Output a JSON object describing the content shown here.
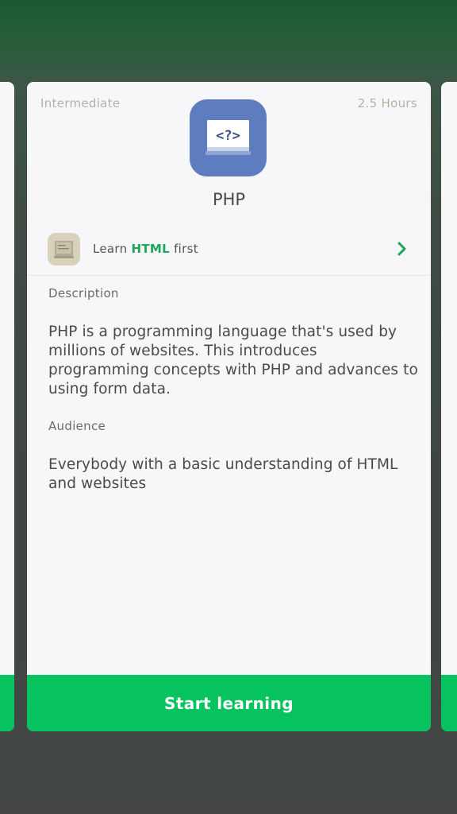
{
  "card": {
    "level": "Intermediate",
    "duration": "2.5 Hours",
    "icon": "php-code-book-icon",
    "icon_color": "#5d7dc0",
    "title": "PHP",
    "prereq": {
      "icon": "html-book-icon",
      "prefix": "Learn",
      "highlight": "HTML",
      "suffix": "first",
      "highlight_color": "#1fa55a"
    },
    "description_label": "Description",
    "description_text": "PHP is a programming language that's used by millions of websites. This introduces programming concepts with PHP and advances to using form data.",
    "audience_label": "Audience",
    "audience_text": "Everybody with a basic understanding of HTML and websites",
    "start_button": "Start learning",
    "accent_color": "#06c35f"
  }
}
